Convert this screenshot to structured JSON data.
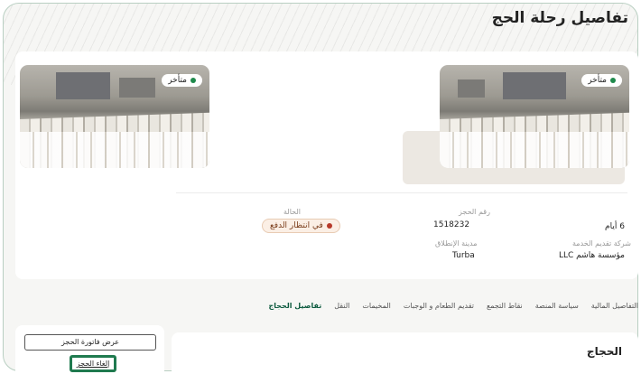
{
  "page": {
    "title": "تفاصيل رحلة الحج"
  },
  "gallery": {
    "items": [
      {
        "badge": "متأخر"
      },
      {
        "badge": "متأخر"
      }
    ]
  },
  "details": {
    "status_label": "الحالة",
    "status_value": "في انتظار الدفع",
    "booking_no_label": "رقم الحجز",
    "booking_no_value": "1518232",
    "duration_value": "6 أيام",
    "departure_city_label": "مدينة الإنطلاق",
    "departure_city_value": "Turba",
    "provider_label": "شركة تقديم الخدمة",
    "provider_value": "مؤسسة هاشم LLC"
  },
  "tabs": [
    {
      "label": "تفاصيل الحجاج",
      "active": true
    },
    {
      "label": "النقل",
      "active": false
    },
    {
      "label": "المخيمات",
      "active": false
    },
    {
      "label": "تقديم الطعام و الوجبات",
      "active": false
    },
    {
      "label": "نقاط التجمع",
      "active": false
    },
    {
      "label": "سياسة المنصة",
      "active": false
    },
    {
      "label": "التفاصيل المالية",
      "active": false
    }
  ],
  "section": {
    "title": "الحجاج"
  },
  "actions": {
    "view_invoice": "عرض فاتورة الحجز",
    "cancel_booking": "إلغاء الحجز"
  },
  "colors": {
    "accent": "#0c5a3e",
    "border": "#b9cfc2",
    "late": "#1f8a4c",
    "pending": "#b73a2a"
  }
}
